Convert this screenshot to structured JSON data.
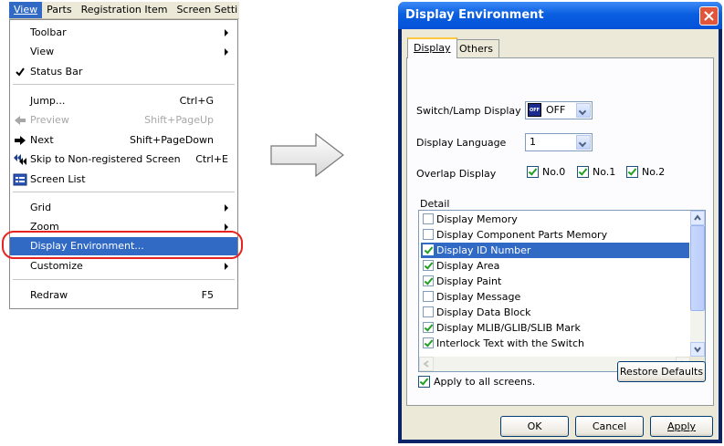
{
  "menubar": {
    "items": [
      "View",
      "Parts",
      "Registration Item",
      "Screen Setti"
    ]
  },
  "menu": {
    "toolbar": "Toolbar",
    "view": "View",
    "status_bar": "Status Bar",
    "jump": "Jump...",
    "jump_shortcut": "Ctrl+G",
    "preview": "Preview",
    "preview_shortcut": "Shift+PageUp",
    "next": "Next",
    "next_shortcut": "Shift+PageDown",
    "skip": "Skip to Non-registered Screen",
    "skip_shortcut": "Ctrl+E",
    "screen_list": "Screen List",
    "grid": "Grid",
    "zoom": "Zoom",
    "display_environment": "Display Environment...",
    "customize": "Customize",
    "redraw": "Redraw",
    "redraw_shortcut": "F5"
  },
  "dialog": {
    "title": "Display Environment",
    "tabs": [
      "Display",
      "Others"
    ],
    "switch_lamp_label": "Switch/Lamp Display",
    "switch_lamp_icon_text": "OFF",
    "switch_lamp_value": "OFF",
    "language_label": "Display Language",
    "language_value": "1",
    "overlap_label": "Overlap Display",
    "overlap_options": [
      {
        "label": "No.0",
        "checked": true
      },
      {
        "label": "No.1",
        "checked": true
      },
      {
        "label": "No.2",
        "checked": true
      }
    ],
    "detail_label": "Detail",
    "detail_items": [
      {
        "label": "Display Memory",
        "checked": false
      },
      {
        "label": "Display Component Parts Memory",
        "checked": false
      },
      {
        "label": "Display ID Number",
        "checked": true,
        "selected": true
      },
      {
        "label": "Display Area",
        "checked": true
      },
      {
        "label": "Display Paint",
        "checked": true
      },
      {
        "label": "Display Message",
        "checked": false
      },
      {
        "label": "Display Data Block",
        "checked": false
      },
      {
        "label": "Display MLIB/GLIB/SLIB Mark",
        "checked": true
      },
      {
        "label": "Interlock Text with the Switch",
        "checked": true
      }
    ],
    "restore_defaults": "Restore Defaults",
    "apply_all": "Apply to all screens.",
    "apply_all_checked": true,
    "ok": "OK",
    "cancel": "Cancel",
    "apply": "Apply"
  },
  "colors": {
    "highlight": "#316ac5",
    "callout": "#e8221f",
    "titlebar": "#0a5fe0"
  }
}
